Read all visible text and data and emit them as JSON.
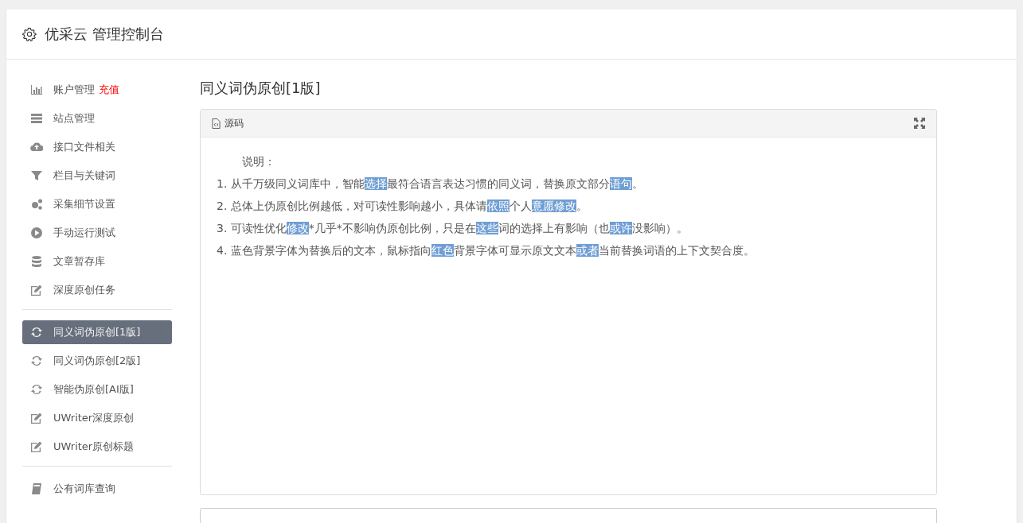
{
  "header": {
    "title": "优采云 管理控制台"
  },
  "sidebar": {
    "groups": [
      {
        "items": [
          {
            "label": "账户管理",
            "badge": "充值",
            "selected": false
          },
          {
            "label": "站点管理",
            "selected": false
          },
          {
            "label": "接口文件相关",
            "selected": false
          },
          {
            "label": "栏目与关键词",
            "selected": false
          },
          {
            "label": "采集细节设置",
            "selected": false
          },
          {
            "label": "手动运行测试",
            "selected": false
          },
          {
            "label": "文章暂存库",
            "selected": false
          },
          {
            "label": "深度原创任务",
            "selected": false
          }
        ]
      },
      {
        "items": [
          {
            "label": "同义词伪原创[1版]",
            "selected": true
          },
          {
            "label": "同义词伪原创[2版]",
            "selected": false
          },
          {
            "label": "智能伪原创[AI版]",
            "selected": false
          },
          {
            "label": "UWriter深度原创",
            "selected": false
          },
          {
            "label": "UWriter原创标题",
            "selected": false
          }
        ]
      },
      {
        "items": [
          {
            "label": "公有词库查询",
            "selected": false
          }
        ]
      }
    ]
  },
  "page_title": "同义词伪原创[1版]",
  "editor": {
    "toolbar_label": "源码",
    "heading": "说明：",
    "lines": [
      [
        {
          "text": "1. 从千万级同义词库中，智能",
          "highlight": false
        },
        {
          "text": "选择",
          "highlight": true
        },
        {
          "text": "最符合语言表达习惯的同义词，替换原文部分",
          "highlight": false
        },
        {
          "text": "语句",
          "highlight": true
        },
        {
          "text": "。",
          "highlight": false
        }
      ],
      [
        {
          "text": "2. 总体上伪原创比例越低，对可读性影响越小，具体请",
          "highlight": false
        },
        {
          "text": "依照",
          "highlight": true
        },
        {
          "text": "个人",
          "highlight": false
        },
        {
          "text": "意愿",
          "highlight": true
        },
        {
          "text": "修改",
          "highlight": true
        },
        {
          "text": "。",
          "highlight": false
        }
      ],
      [
        {
          "text": "3. 可读性优化",
          "highlight": false
        },
        {
          "text": "修改",
          "highlight": true
        },
        {
          "text": "*几乎*不影响伪原创比例，只是在",
          "highlight": false
        },
        {
          "text": "这些",
          "highlight": true
        },
        {
          "text": "词的选择上有影响（也",
          "highlight": false
        },
        {
          "text": "或许",
          "highlight": true
        },
        {
          "text": "没影响）。",
          "highlight": false
        }
      ],
      [
        {
          "text": "4. 蓝色背景字体为替换后的文本，鼠标指向",
          "highlight": false
        },
        {
          "text": "红色",
          "highlight": true
        },
        {
          "text": "背景字体可显示原文文本",
          "highlight": false
        },
        {
          "text": "或者",
          "highlight": true
        },
        {
          "text": "当前替换词语的上下文契合度。",
          "highlight": false
        }
      ]
    ]
  }
}
